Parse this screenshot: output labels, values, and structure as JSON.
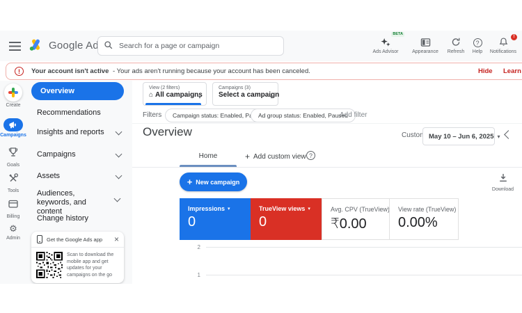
{
  "colors": {
    "accent_blue": "#1a73e8",
    "scorecard_red": "#d93025",
    "alert_red": "#c5221f",
    "surface_grey": "#f8f9fa",
    "google_logo": [
      "#4285f4",
      "#fbbc04",
      "#34a853",
      "#ea4335"
    ]
  },
  "icons": {
    "menu-icon": "hamburger bars",
    "google-ads-logo": "triangle logo",
    "search-icon": "magnifier",
    "sparkle-icon": "ads advisor sparkles",
    "appearance-icon": "panel window",
    "refresh-icon": "circular arrow",
    "help-icon": "question mark circle",
    "bell-icon": "notification bell",
    "home-icon": "house",
    "caret-icon": "▾",
    "close-icon": "×",
    "download-icon": "arrow into tray",
    "qr-code": "qr matrix"
  },
  "topbar": {
    "brand": "Google Ads",
    "search": {
      "placeholder": "Search for a page or campaign"
    },
    "actions": [
      {
        "label": "Ads Advisor",
        "badge": "BETA"
      },
      {
        "label": "Appearance"
      },
      {
        "label": "Refresh"
      },
      {
        "label": "Help"
      },
      {
        "label": "Notifications",
        "alert": "!"
      }
    ]
  },
  "banner": {
    "title": "Your account isn't active",
    "message": "- Your ads aren't running because your account has been canceled.",
    "hide": "Hide",
    "learn_more": "Learn more"
  },
  "rail": {
    "items": [
      {
        "label": "Create"
      },
      {
        "label": "Campaigns",
        "active": true
      },
      {
        "label": "Goals"
      },
      {
        "label": "Tools"
      },
      {
        "label": "Billing"
      },
      {
        "label": "Admin"
      }
    ]
  },
  "nav": {
    "items": [
      {
        "label": "Overview",
        "active": true
      },
      {
        "label": "Recommendations"
      },
      {
        "label": "Insights and reports",
        "expandable": true
      },
      {
        "label": "Campaigns",
        "expandable": true
      },
      {
        "label": "Assets",
        "expandable": true
      },
      {
        "label": "Audiences, keywords, and content",
        "expandable": true
      },
      {
        "label": "Change history"
      }
    ]
  },
  "app_promo": {
    "title": "Get the Google Ads app",
    "body": "Scan to download the mobile app and get updates for your campaigns on the go"
  },
  "view_controls": {
    "view": {
      "label": "View (2 filters)",
      "value": "All campaigns"
    },
    "campaign": {
      "label": "Campaigns (3)",
      "value": "Select a campaign"
    }
  },
  "filters": {
    "label": "Filters",
    "chips": [
      {
        "text": "Campaign status: Enabled, Paused"
      },
      {
        "text": "Ad group status: Enabled, Paused"
      }
    ],
    "add_filter": "Add filter"
  },
  "page": {
    "title": "Overview",
    "date_mode": "Custom",
    "date_range": "May 10 – Jun 6, 2025"
  },
  "tabs": {
    "home": "Home",
    "add_custom_view": "Add custom view"
  },
  "toolbar": {
    "new_campaign": "New campaign",
    "download": "Download"
  },
  "scorecards": [
    {
      "label": "Impressions",
      "value": "0",
      "style": "blue",
      "dropdown": true
    },
    {
      "label": "TrueView views",
      "value": "0",
      "style": "red",
      "dropdown": true
    },
    {
      "label": "Avg. CPV (TrueView)",
      "value": "₹0.00",
      "style": "plain"
    },
    {
      "label": "View rate (TrueView)",
      "value": "0.00%",
      "style": "plain"
    }
  ],
  "chart": {
    "type": "timeseries",
    "y_ticks": [
      "2",
      "1"
    ],
    "plotted_values": "none (all metrics are 0 for the selected range)"
  }
}
